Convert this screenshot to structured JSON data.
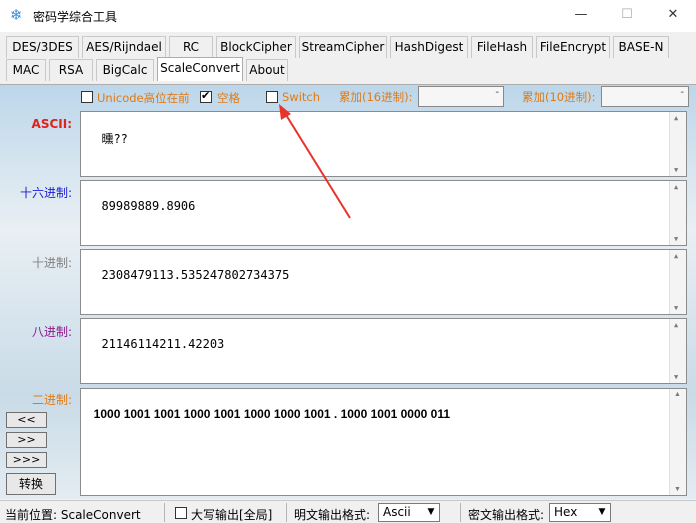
{
  "window": {
    "title": "密码学综合工具",
    "icon": "snowflake-icon",
    "min": "—",
    "max": "☐",
    "close": "✕"
  },
  "tabs": [
    {
      "label": "DES/3DES"
    },
    {
      "label": "AES/Rijndael"
    },
    {
      "label": "RC"
    },
    {
      "label": "BlockCipher"
    },
    {
      "label": "StreamCipher"
    },
    {
      "label": "HashDigest"
    },
    {
      "label": "FileHash"
    },
    {
      "label": "FileEncrypt"
    },
    {
      "label": "BASE-N"
    },
    {
      "label": "MAC"
    },
    {
      "label": "RSA"
    },
    {
      "label": "BigCalc"
    },
    {
      "label": "ScaleConvert"
    },
    {
      "label": "About"
    }
  ],
  "active_tab": "ScaleConvert",
  "options": {
    "unicode_high_first": {
      "label": "Unicode高位在前",
      "checked": false
    },
    "space": {
      "label": "空格",
      "checked": true
    },
    "switch": {
      "label": "Switch",
      "checked": false
    },
    "acc16_label": "累加(16进制):",
    "acc16_value": "",
    "acc10_label": "累加(10进制):",
    "acc10_value": "",
    "spin": "-"
  },
  "fields": {
    "ascii": {
      "label": "ASCII:",
      "value": "曛??",
      "color": "#e0201a"
    },
    "hex": {
      "label": "十六进制:",
      "value": "89989889.8906",
      "color": "#1a1ad6"
    },
    "dec": {
      "label": "十进制:",
      "value": "2308479113.535247802734375",
      "color": "#808080"
    },
    "oct": {
      "label": "八进制:",
      "value": "21146114211.42203",
      "color": "#8a1a8a"
    },
    "bin": {
      "label": "二进制:",
      "value": "1000 1001 1001 1000 1001 1000 1000 1001 . 1000 1001 0000 011",
      "color": "#e07a16"
    }
  },
  "buttons": {
    "shift_left": "<<",
    "shift_right": ">>",
    "shift_right3": ">>>",
    "convert": "转换"
  },
  "status": {
    "position": "当前位置: ScaleConvert",
    "uppercase_label": "大写输出[全局]",
    "uppercase_checked": false,
    "plain_label": "明文输出格式:",
    "plain_value": "Ascii",
    "cipher_label": "密文输出格式:",
    "cipher_value": "Hex",
    "dropdown": "▼"
  }
}
